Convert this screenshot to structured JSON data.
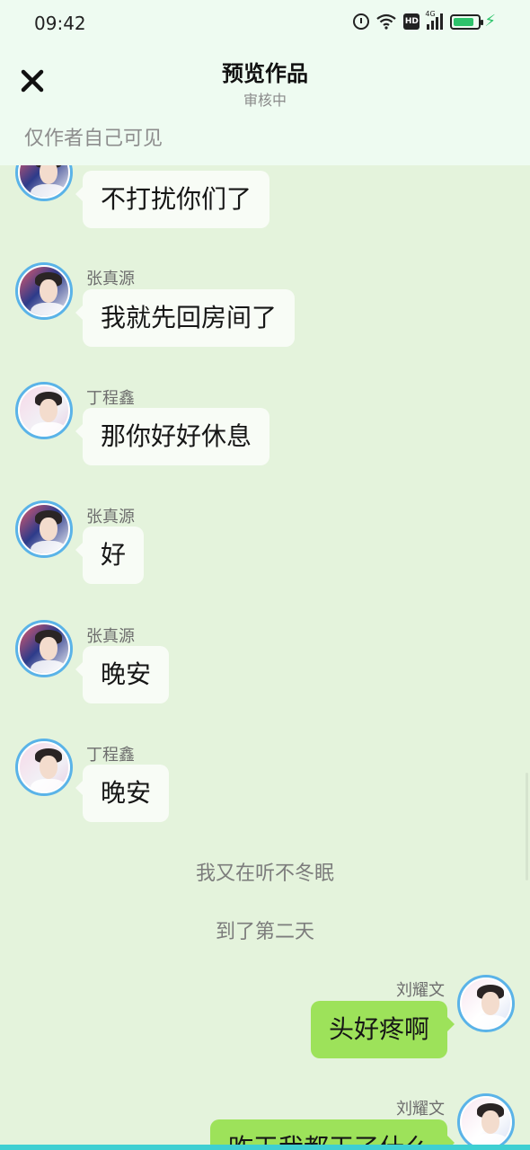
{
  "status_bar": {
    "time": "09:42",
    "hd_label": "HD",
    "network_label": "4G",
    "battery_level": 0.85,
    "icons": [
      "alarm-icon",
      "wifi-icon",
      "hd-icon",
      "signal-icon",
      "battery-icon",
      "charging-icon"
    ]
  },
  "header": {
    "close_icon": "close-icon",
    "title": "预览作品",
    "subtitle": "审核中"
  },
  "visibility_notice": "仅作者自己可见",
  "colors": {
    "header_bg": "#eefbf1",
    "chat_bg": "#e4f3dc",
    "incoming_bubble": "#f8fcf6",
    "outgoing_bubble": "#9de25a",
    "avatar_ring": "#5ab3e8",
    "accent_bar": "#3ecfd2"
  },
  "messages": [
    {
      "sender": "",
      "avatar": "zhang",
      "side": "left",
      "text": "不打扰你们了"
    },
    {
      "sender": "张真源",
      "avatar": "zhang",
      "side": "left",
      "text": "我就先回房间了"
    },
    {
      "sender": "丁程鑫",
      "avatar": "ding",
      "side": "left",
      "text": "那你好好休息"
    },
    {
      "sender": "张真源",
      "avatar": "zhang",
      "side": "left",
      "text": "好"
    },
    {
      "sender": "张真源",
      "avatar": "zhang",
      "side": "left",
      "text": "晚安"
    },
    {
      "sender": "丁程鑫",
      "avatar": "ding",
      "side": "left",
      "text": "晚安"
    },
    {
      "type": "narration",
      "text": "我又在听不冬眠"
    },
    {
      "type": "narration",
      "text": "到了第二天"
    },
    {
      "sender": "刘耀文",
      "avatar": "liu",
      "side": "right",
      "text": "头好疼啊"
    },
    {
      "sender": "刘耀文",
      "avatar": "liu",
      "side": "right",
      "text": "昨天我都干了什么"
    }
  ]
}
